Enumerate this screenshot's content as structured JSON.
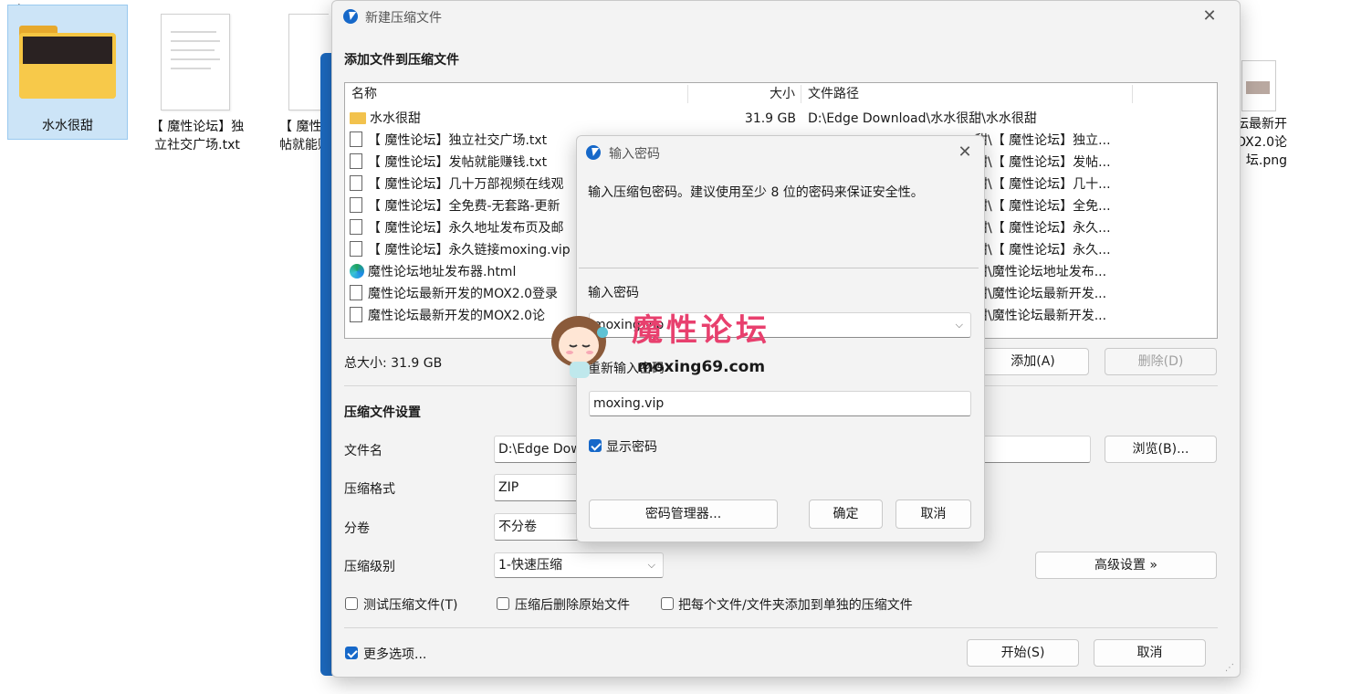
{
  "desktop": {
    "items": [
      {
        "label": "水水很甜"
      },
      {
        "label": "【 魔性论坛】独立社交广场.txt"
      },
      {
        "label": "【 魔性论坛】发帖就能赚钱.txt"
      },
      {
        "label": "魔性论坛最新开发的MOX2.0论坛.png"
      }
    ]
  },
  "main_window": {
    "title": "新建压缩文件",
    "section_title": "添加文件到压缩文件",
    "columns": [
      "名称",
      "大小",
      "文件路径"
    ],
    "files": [
      {
        "icon": "folder-icon",
        "name": "水水很甜",
        "size": "31.9 GB",
        "path": "D:\\Edge Download\\水水很甜\\水水很甜"
      },
      {
        "icon": "txt-file-icon",
        "name": "【 魔性论坛】独立社交广场.txt",
        "size": "",
        "path": "甜\\【 魔性论坛】独立..."
      },
      {
        "icon": "txt-file-icon",
        "name": "【 魔性论坛】发帖就能赚钱.txt",
        "size": "",
        "path": "甜\\【 魔性论坛】发帖..."
      },
      {
        "icon": "txt-file-icon",
        "name": "【 魔性论坛】几十万部视频在线观",
        "size": "",
        "path": "甜\\【 魔性论坛】几十..."
      },
      {
        "icon": "txt-file-icon",
        "name": "【 魔性论坛】全免费-无套路-更新",
        "size": "",
        "path": "甜\\【 魔性论坛】全免..."
      },
      {
        "icon": "txt-file-icon",
        "name": "【 魔性论坛】永久地址发布页及邮",
        "size": "",
        "path": "甜\\【 魔性论坛】永久..."
      },
      {
        "icon": "txt-file-icon",
        "name": "【 魔性论坛】永久链接moxing.vip",
        "size": "",
        "path": "甜\\【 魔性论坛】永久..."
      },
      {
        "icon": "edge-icon",
        "name": "魔性论坛地址发布器.html",
        "size": "",
        "path": "甜\\魔性论坛地址发布..."
      },
      {
        "icon": "png-file-icon",
        "name": "魔性论坛最新开发的MOX2.0登录",
        "size": "",
        "path": "甜\\魔性论坛最新开发..."
      },
      {
        "icon": "png-file-icon",
        "name": "魔性论坛最新开发的MOX2.0论",
        "size": "",
        "path": "甜\\魔性论坛最新开发..."
      }
    ],
    "total_size": "总大小: 31.9 GB",
    "add_button": "添加(A)",
    "delete_button": "删除(D)",
    "settings_title": "压缩文件设置",
    "filename_label": "文件名",
    "filename_value": "D:\\Edge Dow",
    "browse_button": "浏览(B)...",
    "format_label": "压缩格式",
    "format_value": "ZIP",
    "volume_label": "分卷",
    "volume_value": "不分卷",
    "level_label": "压缩级别",
    "level_value": "1-快速压缩",
    "advanced_button": "高级设置 »",
    "opt_test": "测试压缩文件(T)",
    "opt_delete": "压缩后删除原始文件",
    "opt_separate": "把每个文件/文件夹添加到单独的压缩文件",
    "more_options": "更多选项...",
    "start_button": "开始(S)",
    "cancel_button": "取消"
  },
  "password_dialog": {
    "title": "输入密码",
    "description": "输入压缩包密码。建议使用至少 8 位的密码来保证安全性。",
    "password_label": "输入密码",
    "password_value": "moxing.vip",
    "confirm_label": "重新输入密码",
    "confirm_value": "moxing.vip",
    "show_password": "显示密码",
    "manager_button": "密码管理器...",
    "ok_button": "确定",
    "cancel_button": "取消"
  },
  "watermark": {
    "title": "魔性论坛",
    "url": "moxing69.com"
  },
  "colors": {
    "accent": "#1668c9",
    "watermark": "#e8406e"
  }
}
